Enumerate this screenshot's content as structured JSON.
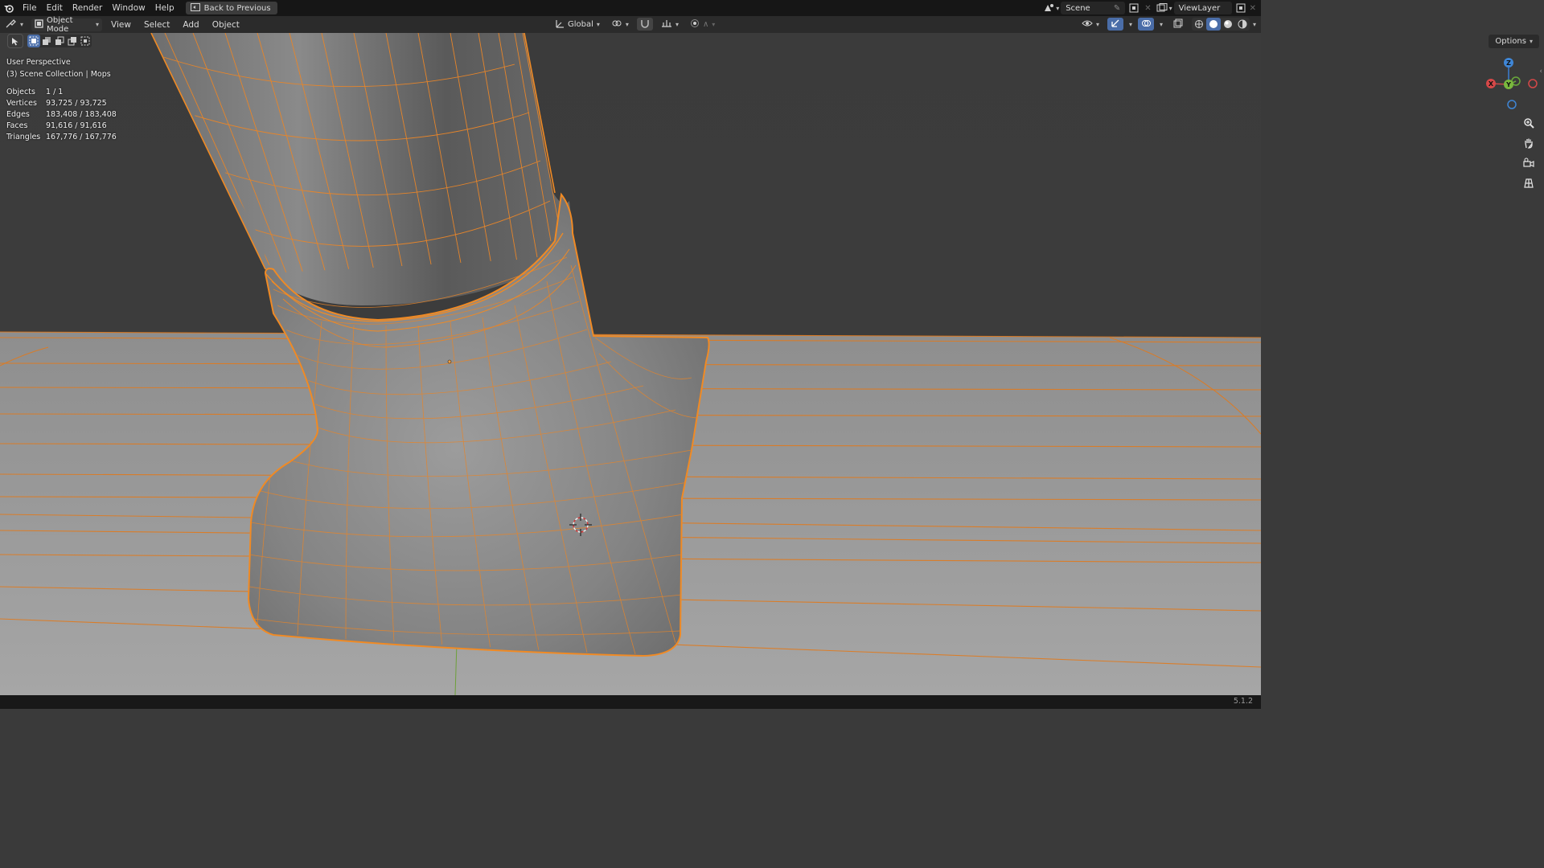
{
  "topbar": {
    "menus": [
      "File",
      "Edit",
      "Render",
      "Window",
      "Help"
    ],
    "back_button": "Back to Previous",
    "scene": "Scene",
    "view_layer": "ViewLayer"
  },
  "header": {
    "mode": "Object Mode",
    "menus": [
      "View",
      "Select",
      "Add",
      "Object"
    ],
    "transform_orientation": "Global",
    "options": "Options"
  },
  "overlay": {
    "perspective": "User Perspective",
    "collection": "(3) Scene Collection | Mops"
  },
  "stats": [
    {
      "label": "Objects",
      "value": "1 / 1"
    },
    {
      "label": "Vertices",
      "value": "93,725 / 93,725"
    },
    {
      "label": "Edges",
      "value": "183,408 / 183,408"
    },
    {
      "label": "Faces",
      "value": "91,616 / 91,616"
    },
    {
      "label": "Triangles",
      "value": "167,776 / 167,776"
    }
  ],
  "gizmo": {
    "x": "X",
    "y": "Y",
    "z": "Z"
  },
  "icons": [
    "blender-logo-icon",
    "back-icon",
    "scene-icon",
    "pin-icon",
    "new-scene-icon",
    "view-layer-icon",
    "editor-type-icon",
    "object-mode-icon",
    "global-icon",
    "pivot-icon",
    "snap-icon",
    "proportional-icon",
    "visibility-icon",
    "gizmo-icon",
    "overlay-icon",
    "xray-icon",
    "shading-wire-icon",
    "shading-solid-icon",
    "shading-material-icon",
    "shading-rendered-icon",
    "select-box-icon",
    "zoom-icon",
    "pan-icon",
    "camera-icon",
    "grid-icon"
  ],
  "colors": {
    "selection": "#f08a24",
    "accent": "#4a6da8"
  },
  "status": {
    "version": "5.1.2"
  }
}
